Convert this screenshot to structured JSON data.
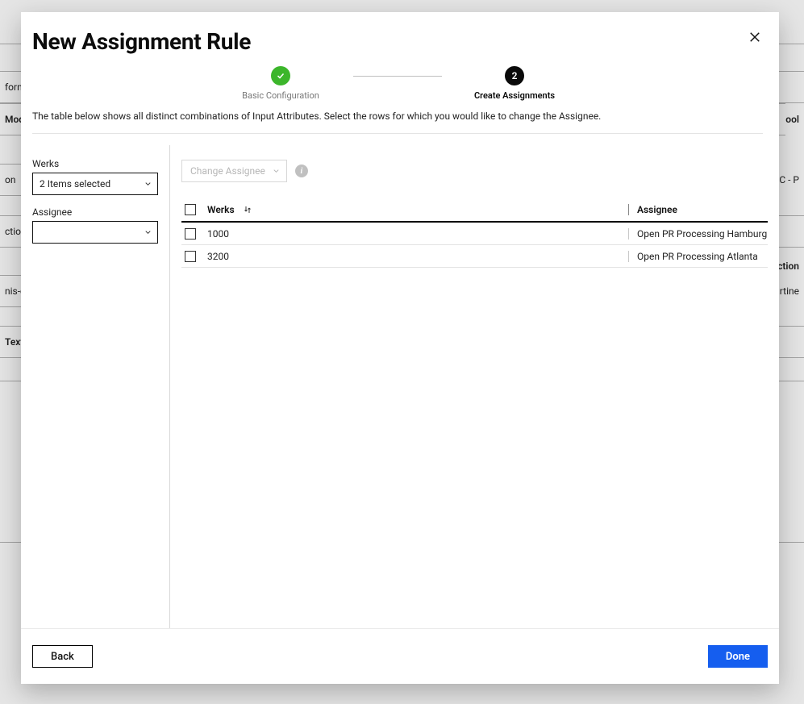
{
  "modal": {
    "title": "New Assignment Rule",
    "description": "The table below shows all distinct combinations of Input Attributes. Select the rows for which you would like to change the Assignee.",
    "steps": [
      {
        "label": "Basic Configuration",
        "state": "done"
      },
      {
        "label": "Create Assignments",
        "state": "current",
        "number": "2"
      }
    ],
    "sidebar": {
      "werks_label": "Werks",
      "werks_select_value": "2 Items selected",
      "assignee_label": "Assignee",
      "assignee_select_value": ""
    },
    "toolbar": {
      "change_assignee_label": "Change Assignee"
    },
    "table": {
      "header_werks": "Werks",
      "header_assignee": "Assignee",
      "rows": [
        {
          "werks": "1000",
          "assignee": "Open PR Processing Hamburg"
        },
        {
          "werks": "3200",
          "assignee": "Open PR Processing Atlanta"
        }
      ]
    },
    "footer": {
      "back": "Back",
      "done": "Done"
    }
  },
  "background": {
    "left_fragments": [
      "forma",
      "Model",
      "on",
      "ction",
      "nis-c",
      "Text"
    ],
    "right_fragments": [
      "ool",
      "CC - P",
      "ction",
      "martine"
    ]
  }
}
